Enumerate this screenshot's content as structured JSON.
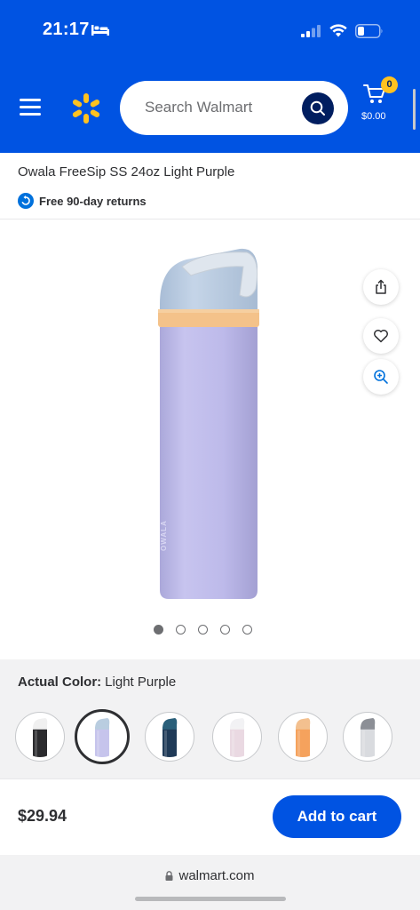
{
  "status_bar": {
    "time": "21:17"
  },
  "header": {
    "search_placeholder": "Search Walmart",
    "cart_count": "0",
    "cart_total": "$0.00"
  },
  "product": {
    "title": "Owala FreeSip SS 24oz Light Purple",
    "returns": "Free 90-day returns",
    "image_count": 5,
    "active_image": 1,
    "actual_color_label": "Actual Color:",
    "actual_color_value": "Light Purple",
    "swatches": [
      {
        "color": "#2b2b2e",
        "accent": "#f0f0f0"
      },
      {
        "color": "#c6c4ec",
        "accent": "#b9cde0"
      },
      {
        "color": "#1f3a57",
        "accent": "#2a5f7a"
      },
      {
        "color": "#ead9e2",
        "accent": "#f2f2f4"
      },
      {
        "color": "#f5a25d",
        "accent": "#f3c08f"
      },
      {
        "color": "#d9dbdf",
        "accent": "#8c8f96"
      }
    ],
    "selected_swatch": 1
  },
  "buy_bar": {
    "price": "$29.94",
    "add_to_cart": "Add to cart"
  },
  "browser": {
    "url": "walmart.com"
  },
  "colors": {
    "brand_blue": "#0053e2",
    "spark_yellow": "#ffc220",
    "navy": "#001e60"
  }
}
